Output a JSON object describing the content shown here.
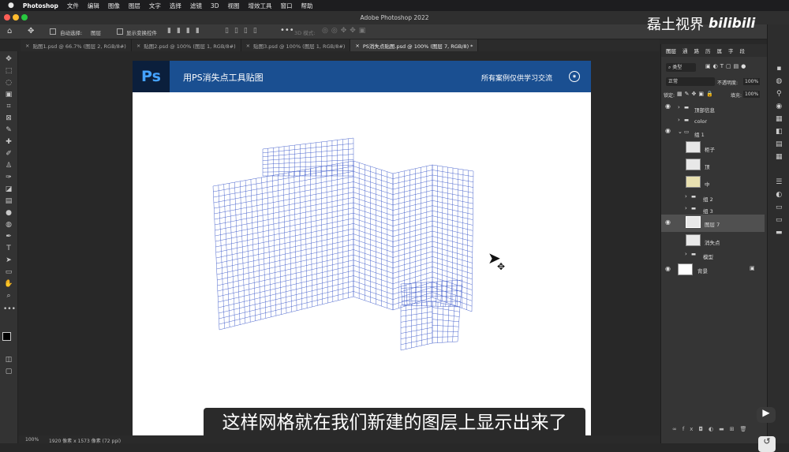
{
  "menubar": {
    "app": "Photoshop",
    "items": [
      "文件",
      "编辑",
      "图像",
      "图层",
      "文字",
      "选择",
      "滤镜",
      "3D",
      "视图",
      "增效工具",
      "窗口",
      "帮助"
    ]
  },
  "window": {
    "title": "Adobe Photoshop 2022"
  },
  "options_bar": {
    "auto_select_label": "自动选择:",
    "auto_select_value": "图层",
    "show_transform_label": "显示变换控件",
    "mode_3d_label": "3D 模式:"
  },
  "tabs": [
    {
      "label": "贴图1.psd @ 66.7% (图层 2, RGB/8#)",
      "active": false
    },
    {
      "label": "贴图2.psd @ 100% (图层 1, RGB/8#)",
      "active": false
    },
    {
      "label": "贴图3.psd @ 100% (图层 1, RGB/8#)",
      "active": false
    },
    {
      "label": "PS消失点贴图.psd @ 100% (图层 7, RGB/8) *",
      "active": true
    }
  ],
  "document": {
    "banner_logo": "Ps",
    "banner_title": "用PS消失点工具贴图",
    "banner_note": "所有案例仅供学习交流"
  },
  "status": {
    "zoom": "100%",
    "size": "1920 像素 x 1573 像素 (72 ppi)"
  },
  "layers_panel": {
    "tabs": [
      "图层",
      "通",
      "路",
      "历",
      "属",
      "字",
      "段"
    ],
    "filter_label": "类型",
    "blend_mode": "正常",
    "opacity_label": "不透明度:",
    "opacity_value": "100%",
    "lock_label": "锁定:",
    "fill_label": "填充:",
    "fill_value": "100%",
    "layers": [
      {
        "name": "顶部信息",
        "kind": "group"
      },
      {
        "name": "color",
        "kind": "group"
      },
      {
        "name": "组 1",
        "kind": "group-open"
      },
      {
        "name": "柜子",
        "kind": "layer"
      },
      {
        "name": "顶",
        "kind": "layer"
      },
      {
        "name": "中",
        "kind": "layer"
      },
      {
        "name": "组 2",
        "kind": "group"
      },
      {
        "name": "组 3",
        "kind": "group"
      },
      {
        "name": "图层 7",
        "kind": "layer-selected"
      },
      {
        "name": "消失点",
        "kind": "layer"
      },
      {
        "name": "模型",
        "kind": "group"
      },
      {
        "name": "背景",
        "kind": "background"
      }
    ],
    "bottom_fx": "fx"
  },
  "watermark": {
    "text": "磊土视界",
    "logo": "bilibili"
  },
  "subtitle": "这样网格就在我们新建的图层上显示出来了",
  "colors": {
    "grid": "#3a57c8",
    "banner": "#1a4f91",
    "accent": "#45a2ff"
  }
}
